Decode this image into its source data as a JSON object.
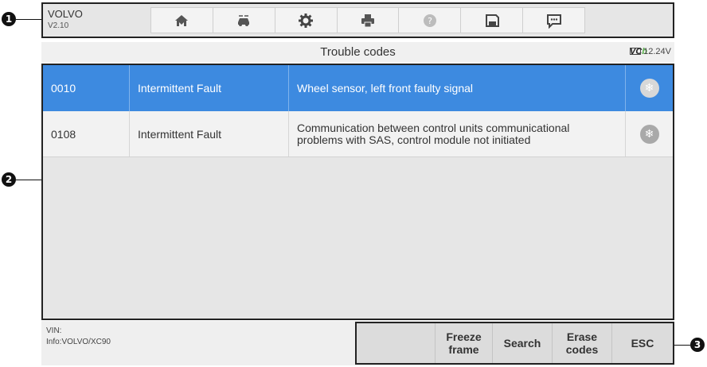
{
  "app": {
    "name": "VOLVO",
    "version": "V2.10"
  },
  "toolbar": {
    "items": [
      {
        "icon": "home-icon"
      },
      {
        "icon": "vehicle-swap-icon"
      },
      {
        "icon": "settings-icon"
      },
      {
        "icon": "print-icon"
      },
      {
        "icon": "help-icon"
      },
      {
        "icon": "save-icon"
      },
      {
        "icon": "message-icon"
      }
    ]
  },
  "header": {
    "title": "Trouble codes",
    "vcb_prefix": "VC",
    "vcb_suffix": "b",
    "voltage": "12.24V"
  },
  "codes": [
    {
      "code": "0010",
      "status": "Intermittent Fault",
      "description": "Wheel sensor, left front faulty signal",
      "selected": true
    },
    {
      "code": "0108",
      "status": "Intermittent Fault",
      "description": "Communication between control units communicational problems with SAS, control module not initiated",
      "selected": false
    }
  ],
  "footer": {
    "vin_label": "VIN:",
    "info": "Info:VOLVO/XC90"
  },
  "buttons": {
    "freeze_frame": "Freeze frame",
    "search": "Search",
    "erase_codes": "Erase codes",
    "esc": "ESC"
  },
  "callouts": [
    "1",
    "2",
    "3"
  ],
  "colors": {
    "selected_row": "#3d8ae0",
    "vcb_accent": "#57b04a"
  }
}
